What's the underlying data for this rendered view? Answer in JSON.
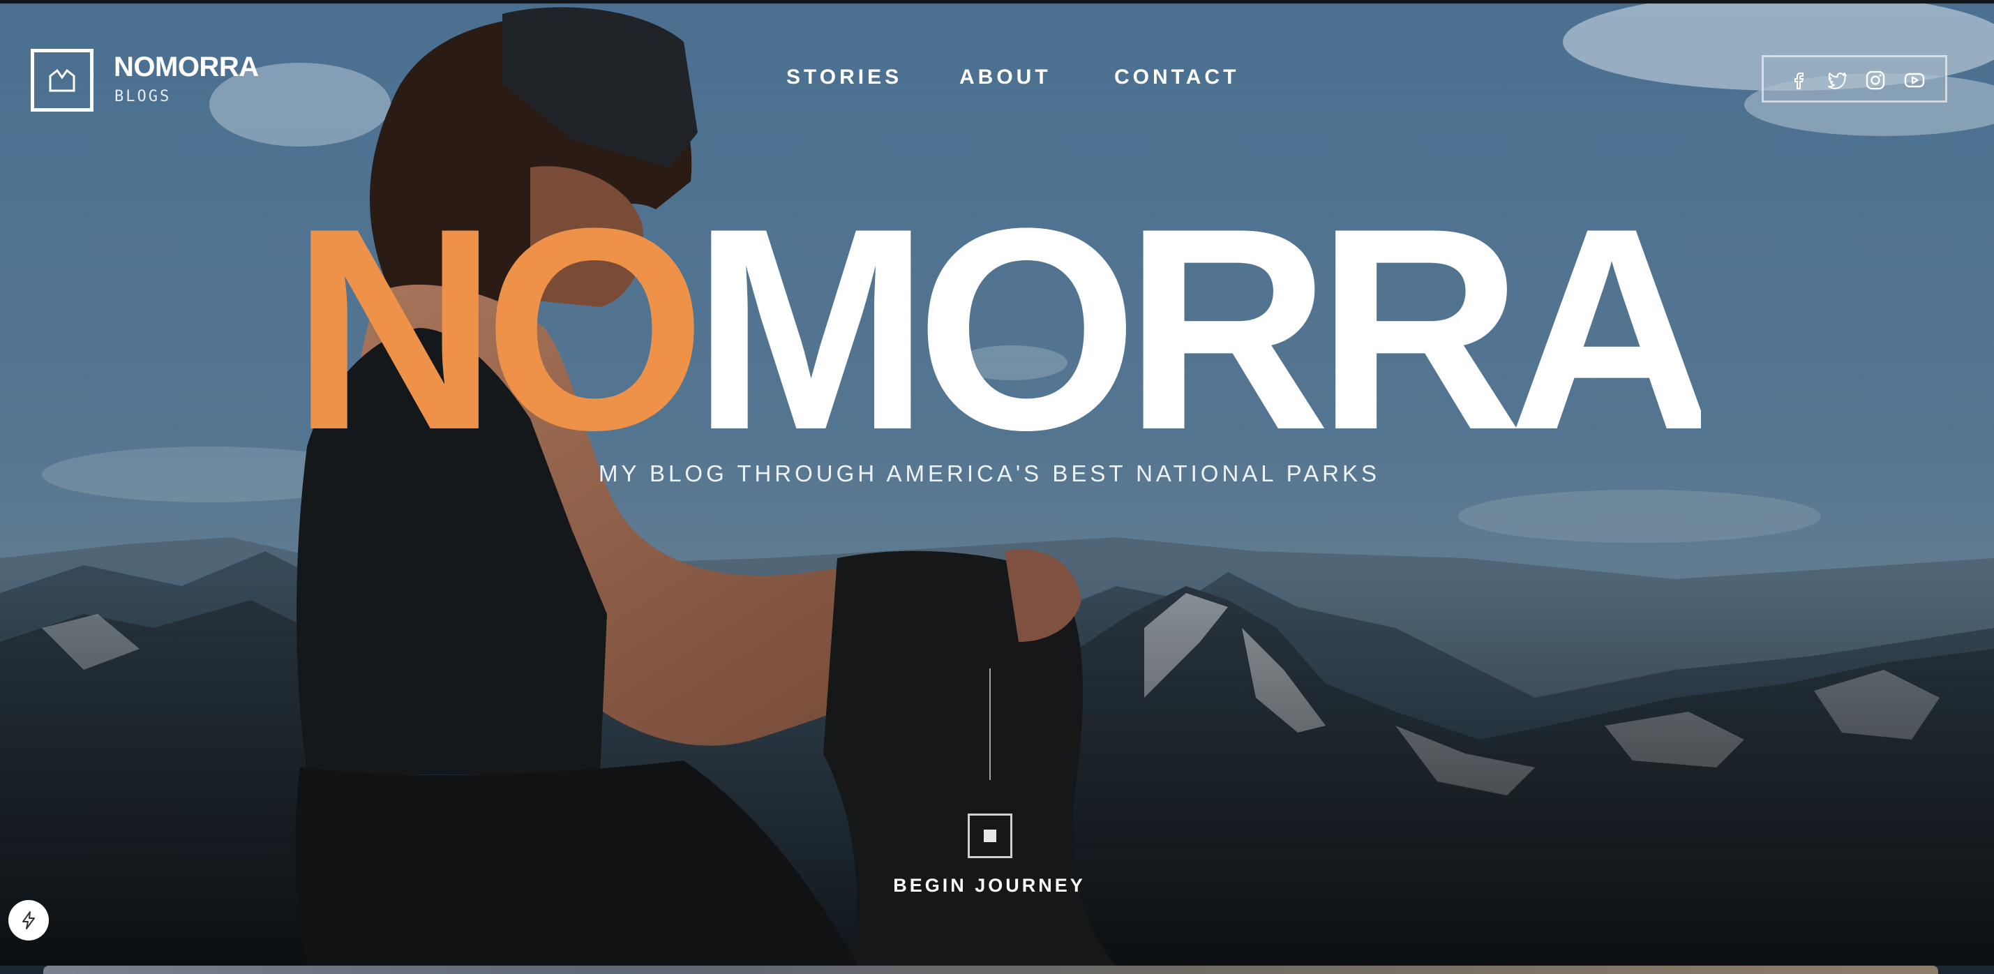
{
  "brand": {
    "name": "NOMORRA",
    "sub": "BLOGS"
  },
  "nav": {
    "items": [
      "STORIES",
      "ABOUT",
      "CONTACT"
    ]
  },
  "social": {
    "icons": [
      "facebook-icon",
      "twitter-icon",
      "instagram-icon",
      "youtube-icon"
    ]
  },
  "hero": {
    "title_accent": "NO",
    "title_rest": "MORRA",
    "tagline": "MY BLOG THROUGH AMERICA'S BEST NATIONAL PARKS",
    "cta_label": "BEGIN JOURNEY"
  },
  "colors": {
    "accent": "#ee924a",
    "text": "#ffffff"
  },
  "widget": {
    "icon": "lightning-icon"
  }
}
